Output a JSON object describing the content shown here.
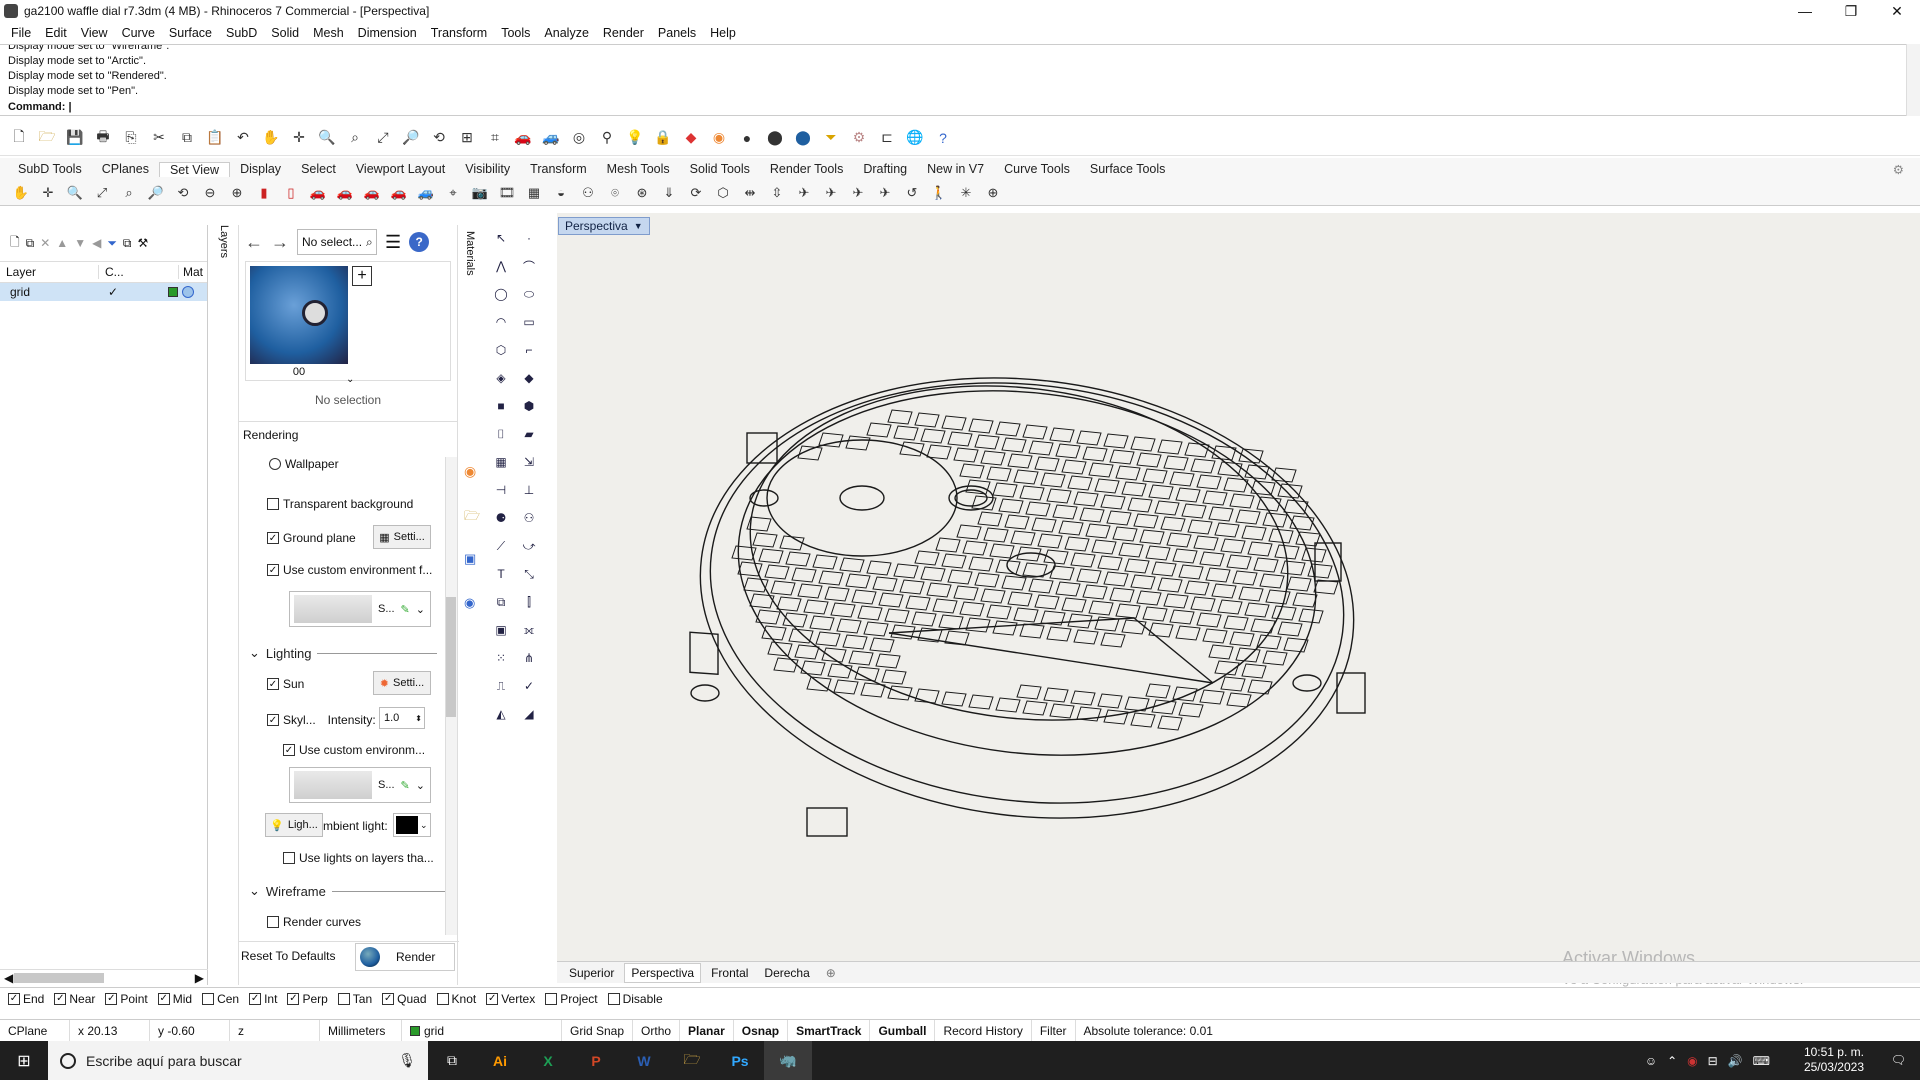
{
  "window": {
    "title": "ga2100 waffle dial r7.3dm (4 MB) - Rhinoceros 7 Commercial - [Perspectiva]"
  },
  "menu": [
    "File",
    "Edit",
    "View",
    "Curve",
    "Surface",
    "SubD",
    "Solid",
    "Mesh",
    "Dimension",
    "Transform",
    "Tools",
    "Analyze",
    "Render",
    "Panels",
    "Help"
  ],
  "command_history": [
    "Display mode set to \"Wireframe\".",
    "Display mode set to \"Arctic\".",
    "Display mode set to \"Rendered\".",
    "Display mode set to \"Pen\"."
  ],
  "command_prompt": "Command:",
  "toolbar_tabs": [
    "SubD Tools",
    "CPlanes",
    "Set View",
    "Display",
    "Select",
    "Viewport Layout",
    "Visibility",
    "Transform",
    "Mesh Tools",
    "Solid Tools",
    "Render Tools",
    "Drafting",
    "New in V7",
    "Curve Tools",
    "Surface Tools"
  ],
  "active_tab": "Set View",
  "layers": {
    "col_layer": "Layer",
    "col_cplane": "C...",
    "col_material": "Mat",
    "rows": [
      {
        "name": "grid"
      }
    ]
  },
  "layers_tab_label": "Layers",
  "materials": {
    "select_label": "No select...",
    "thumb_label": "00",
    "no_selection": "No selection",
    "side_tab": "Materials"
  },
  "rendering": {
    "title": "Rendering",
    "wallpaper": "Wallpaper",
    "transparent_bg": "Transparent background",
    "ground_plane": "Ground plane",
    "settings": "Setti...",
    "use_custom_env": "Use custom environment f...",
    "env_short": "S...",
    "lighting": "Lighting",
    "sun": "Sun",
    "skylight": "Skyl...",
    "intensity_label": "Intensity:",
    "intensity_value": "1.0",
    "use_custom_env2": "Use custom environm...",
    "ligh": "Ligh...",
    "ambient": "mbient light:",
    "use_lights_layers": "Use lights on layers tha...",
    "wireframe": "Wireframe",
    "render_curves": "Render curves",
    "reset": "Reset To Defaults",
    "render": "Render"
  },
  "viewport": {
    "name": "Perspectiva"
  },
  "viewport_tabs": [
    "Superior",
    "Perspectiva",
    "Frontal",
    "Derecha"
  ],
  "activate": {
    "line1": "Activar Windows",
    "line2": "Ve a Configuración para activar Windows."
  },
  "osnaps": [
    {
      "label": "End",
      "on": true
    },
    {
      "label": "Near",
      "on": true
    },
    {
      "label": "Point",
      "on": true
    },
    {
      "label": "Mid",
      "on": true
    },
    {
      "label": "Cen",
      "on": false
    },
    {
      "label": "Int",
      "on": true
    },
    {
      "label": "Perp",
      "on": true
    },
    {
      "label": "Tan",
      "on": false
    },
    {
      "label": "Quad",
      "on": true
    },
    {
      "label": "Knot",
      "on": false
    },
    {
      "label": "Vertex",
      "on": true
    },
    {
      "label": "Project",
      "on": false
    },
    {
      "label": "Disable",
      "on": false
    }
  ],
  "status": {
    "cplane": "CPlane",
    "x": "x 20.13",
    "y": "y -0.60",
    "z": "z",
    "units": "Millimeters",
    "layer": "grid",
    "grid_snap": "Grid Snap",
    "ortho": "Ortho",
    "planar": "Planar",
    "osnap": "Osnap",
    "smarttrack": "SmartTrack",
    "gumball": "Gumball",
    "record_history": "Record History",
    "filter": "Filter",
    "tolerance": "Absolute tolerance: 0.01"
  },
  "taskbar": {
    "search_placeholder": "Escribe aquí para buscar",
    "time": "10:51 p. m.",
    "date": "25/03/2023"
  }
}
